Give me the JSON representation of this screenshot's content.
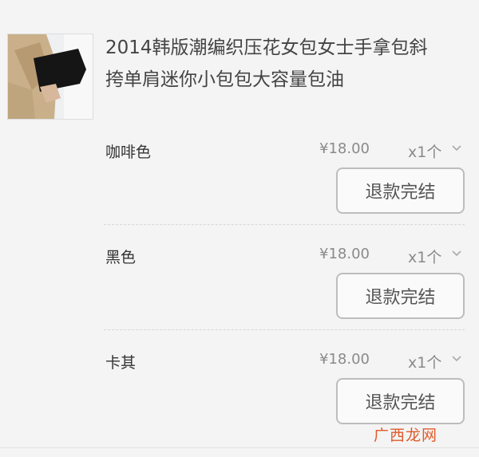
{
  "product": {
    "title_line1": "2014韩版潮编织压花女包女士手拿包斜",
    "title_line2": "挎单肩迷你小包包大容量包油"
  },
  "variants": [
    {
      "color": "咖啡色",
      "price": "¥18.00",
      "qty": "x1个",
      "action": "退款完结"
    },
    {
      "color": "黑色",
      "price": "¥18.00",
      "qty": "x1个",
      "action": "退款完结"
    },
    {
      "color": "卡其",
      "price": "¥18.00",
      "qty": "x1个",
      "action": "退款完结"
    }
  ],
  "watermark": "广西龙网",
  "colors": {
    "watermark": "#e05a2a",
    "button_border": "#bdbdbd",
    "muted": "#8a8a8a"
  },
  "icons": {
    "qty_toggle": "chevron-down-icon"
  }
}
